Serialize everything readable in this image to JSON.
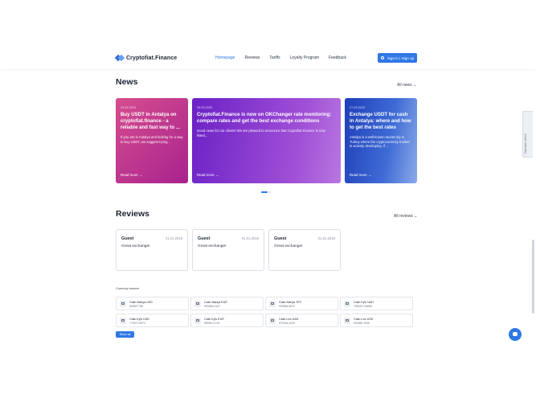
{
  "header": {
    "logo_text": "Cryptofiat.Finance",
    "nav": [
      "Homepage",
      "Reviews",
      "Tariffs",
      "Loyalty Program",
      "Feedback"
    ],
    "signin_label": "Sign in | Sign up"
  },
  "news": {
    "title": "News",
    "all_label": "All news",
    "cards": [
      {
        "date": "03.04.2023",
        "title": "Buy USDT in Antalya on cryptofiat.finance - a reliable and fast way to ...",
        "text": "If you are in Antalya and looking for a way to buy USDT, we suggest trying...",
        "more": "Read more →"
      },
      {
        "date": "29.03.2023",
        "title": "Cryptofiat.Finance is now on OKChanger rate monitoring: compare rates and get the best exchange conditions",
        "text": "Good news for our clients! We are pleased to announce that Cryptofiat.Finance is now listed...",
        "more": "Read more →"
      },
      {
        "date": "27.03.2023",
        "title": "Exchange USDT for cash in Antalya: where and how to get the best rates",
        "text": "Antalya is a well-known tourist city in Turkey where the cryptocurrency market is actively developing. If ...",
        "more": "Read more →"
      }
    ]
  },
  "reviews": {
    "title": "Reviews",
    "all_label": "All reviews",
    "items": [
      {
        "name": "Guest",
        "date": "01.01.2019",
        "text": "Great exchange!"
      },
      {
        "name": "Guest",
        "date": "01.01.2019",
        "text": "Great exchange!"
      },
      {
        "name": "Guest",
        "date": "01.01.2019",
        "text": "Great exchange!"
      }
    ]
  },
  "reserves": {
    "label": "Currency reserve",
    "items": [
      {
        "name": "Cash Alanya USD",
        "value": "969697758"
      },
      {
        "name": "Cash Alanya EUR",
        "value": "993366.0167"
      },
      {
        "name": "Cash Alanya TRY",
        "value": "909366.5872"
      },
      {
        "name": "Cash Kyiv UAH",
        "value": "739422716655"
      },
      {
        "name": "Cash Kyiv USD",
        "value": "779371.9574"
      },
      {
        "name": "Cash Kyiv EUR",
        "value": "999301.2701"
      },
      {
        "name": "Cash Lviv UAH",
        "value": "979318.4429"
      },
      {
        "name": "Cash Lviv USD",
        "value": "993359.7646"
      }
    ],
    "show_all_label": "Show all"
  },
  "side_tab_label": "Operator offline",
  "colors": {
    "accent": "#2f78e4",
    "card1": "#c2378f",
    "card2": "#7a2fc6",
    "card3": "#2a56c6"
  }
}
